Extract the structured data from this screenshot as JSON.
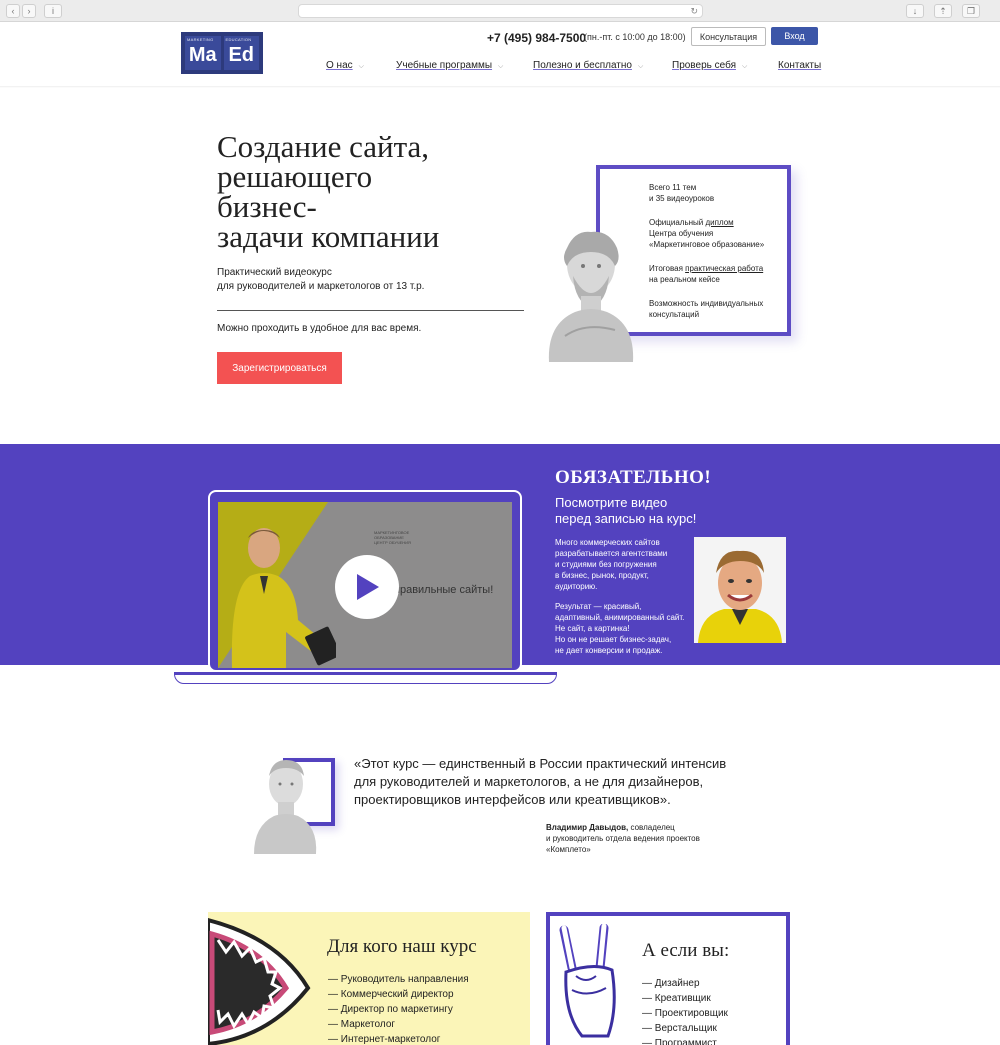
{
  "header": {
    "logo": {
      "left_word": "Ma",
      "right_word": "Ed",
      "left_tiny": "MARKETING",
      "right_tiny": "EDUCATION"
    },
    "phone": "+7 (495) 984-7500",
    "hours": "(пн.-пт. с 10:00 до 18:00)",
    "consult_label": "Консультация",
    "login_label": "Вход",
    "nav": [
      {
        "label": "О нас"
      },
      {
        "label": "Учебные программы"
      },
      {
        "label": "Полезно и бесплатно"
      },
      {
        "label": "Проверь себя"
      },
      {
        "label": "Контакты"
      }
    ]
  },
  "hero": {
    "title_lines": [
      "Создание сайта,",
      "решающего",
      "бизнес-",
      "задачи компании"
    ],
    "sub_line1": "Практический видеокурс",
    "sub_line2": "для руководителей и маркетологов от 13 т.р.",
    "anytime": "Можно проходить в удобное для вас время.",
    "register_label": "Зарегистрироваться",
    "features": {
      "f1_line1": "Всего 11 тем",
      "f1_line2": "и 35 видеоуроков",
      "f2_pre": "Официальный ",
      "f2_link": "диплом",
      "f2_line2": "Центра обучения",
      "f2_line3": "«Маркетинговое образование»",
      "f3_pre": "Итоговая ",
      "f3_link": "практическая работа",
      "f3_line2": "на реальном кейсе",
      "f4_line1": "Возможность индивидуальных",
      "f4_line2": "консультаций"
    }
  },
  "video_section": {
    "title": "ОБЯЗАТЕЛЬНО!",
    "sub_line1": "Посмотрите видео",
    "sub_line2": "перед записью на курс!",
    "p1": [
      "Много коммерческих сайтов",
      "разрабатывается агентствами",
      "и студиями без погружения",
      "в бизнес, рынок, продукт,",
      "аудиторию."
    ],
    "p2": [
      "Результат — красивый,",
      "адаптивный, анимированный сайт.",
      "Не сайт, а картинка!",
      "Но он не решает бизнес-задач,",
      "не дает конверсии и продаж."
    ],
    "video_caption": "правильные сайты!",
    "video_logo": [
      "МАРКЕТИНГОВОЕ",
      "ОБРАЗОВАНИЕ",
      "ЦЕНТР ОБУЧЕНИЯ"
    ]
  },
  "quote": {
    "lines": [
      "«Этот курс — единственный в России практический интенсив",
      "для руководителей и маркетологов, а не для дизайнеров,",
      "проектировщиков интерфейсов или креативщиков»."
    ],
    "author_name": "Владимир Давыдов,",
    "author_role1": " совладелец",
    "author_role2": "и руководитель отдела ведения проектов",
    "author_role3": "«Комплето»"
  },
  "audience": {
    "title": "Для кого наш курс",
    "items": [
      "— Руководитель направления",
      "— Коммерческий директор",
      "— Директор по маркетингу",
      "— Маркетолог",
      "— Интернет-маркетолог"
    ]
  },
  "not_for": {
    "title": "А если вы:",
    "items": [
      "— Дизайнер",
      "— Креативщик",
      "— Проектировщик",
      "— Верстальщик",
      "— Программист"
    ]
  },
  "colors": {
    "purple": "#5342bf",
    "red_button": "#f35252",
    "logo_blue": "#2d3a7c",
    "login_blue": "#3c56a8",
    "card_yellow": "#fbf5b8"
  }
}
